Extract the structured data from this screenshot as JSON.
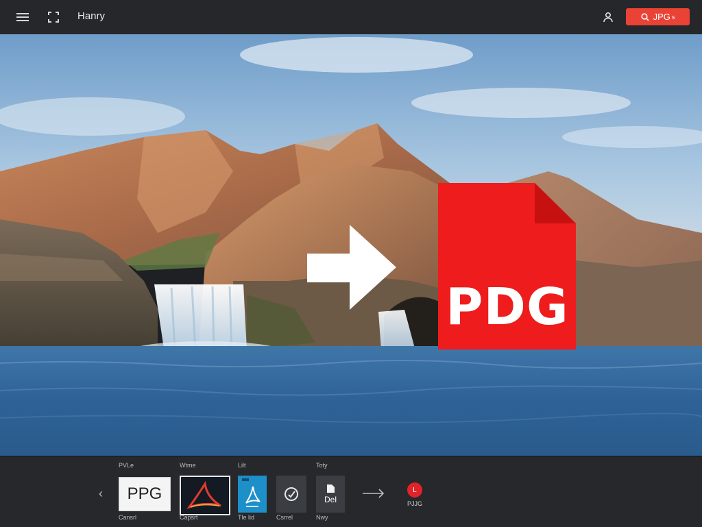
{
  "header": {
    "menu_icon": "menu-icon",
    "crop_icon": "crop-icon",
    "title": "Hanry",
    "user_icon": "user-icon",
    "search_icon": "search-icon",
    "cta_label": "JPG",
    "cta_suffix": "s",
    "accent": "#ea4335"
  },
  "canvas": {
    "overlay_text": "PDG",
    "arrow_icon": "arrow-right-icon",
    "file_icon": "document-icon",
    "file_color": "#ee1c1c"
  },
  "bottom": {
    "prev_icon": "chevron-left-icon",
    "items": [
      {
        "top_label": "PVLe",
        "thumb_text": "PPG",
        "bottom_label": "Cansrl"
      },
      {
        "top_label": "Wtme",
        "thumb_text": "",
        "bottom_label": "Capsrt"
      },
      {
        "top_label": "Lilt",
        "thumb_text": "",
        "bottom_label": "Tle lid"
      },
      {
        "top_label": "",
        "thumb_text": "",
        "bottom_label": "Csrrel"
      },
      {
        "top_label": "Toty",
        "thumb_text": "Del",
        "bottom_label": "Nwy"
      }
    ],
    "arrow_icon": "arrow-right-icon",
    "status_badge": "L",
    "status_label": "PJJG"
  }
}
